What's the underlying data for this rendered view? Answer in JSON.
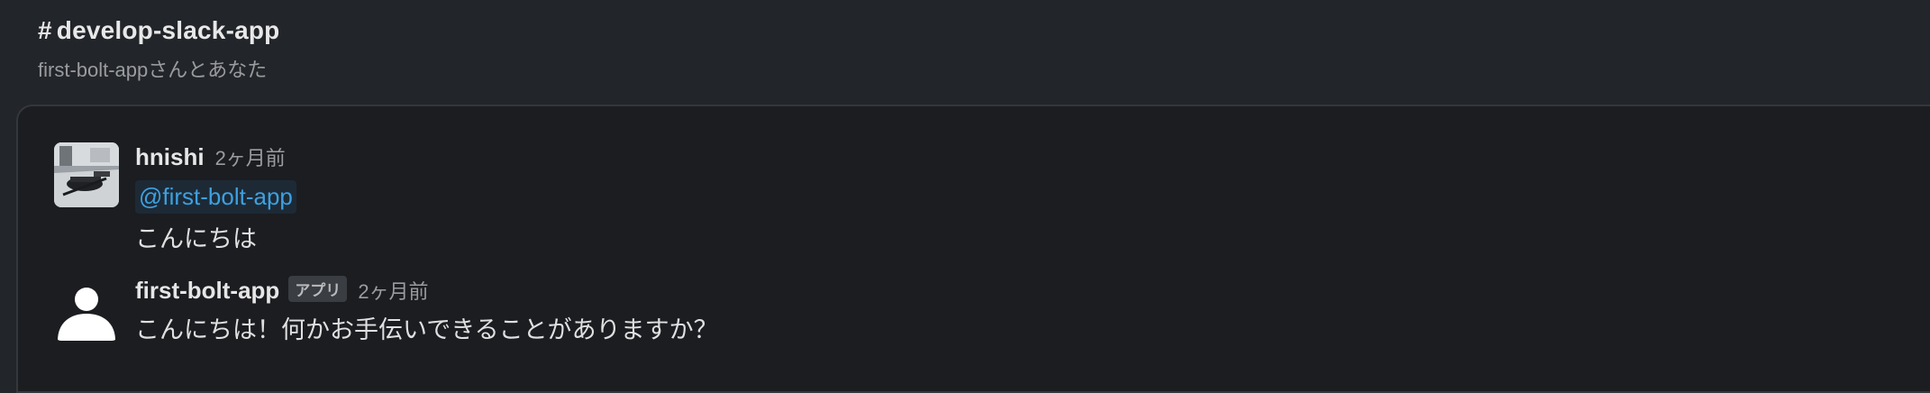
{
  "channel": {
    "hash": "#",
    "name": "develop-slack-app",
    "members_text": "first-bolt-appさんとあなた"
  },
  "messages": [
    {
      "author": "hnishi",
      "time": "2ヶ月前",
      "mention": "@first-bolt-app",
      "text": "こんにちは",
      "avatar_icon": "user-photo"
    },
    {
      "author": "first-bolt-app",
      "badge": "アプリ",
      "time": "2ヶ月前",
      "text": "こんにちは！何かお手伝いできることがありますか？",
      "avatar_icon": "default-user-icon"
    }
  ],
  "colors": {
    "background": "#222529",
    "panel": "#1b1d21",
    "mention": "#3ea0e0",
    "mention_bg": "#1d2a36"
  }
}
